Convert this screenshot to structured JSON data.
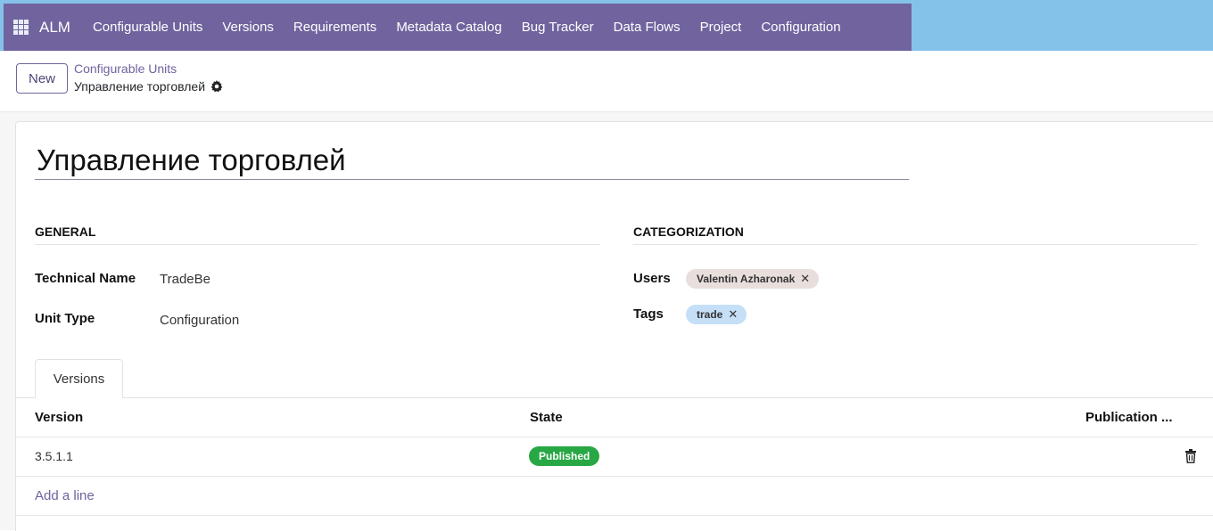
{
  "navbar": {
    "brand": "ALM",
    "items": [
      "Configurable Units",
      "Versions",
      "Requirements",
      "Metadata Catalog",
      "Bug Tracker",
      "Data Flows",
      "Project",
      "Configuration"
    ]
  },
  "control_panel": {
    "new_label": "New",
    "breadcrumb_parent": "Configurable Units",
    "breadcrumb_current": "Управление торговлей"
  },
  "record": {
    "title": "Управление торговлей",
    "general": {
      "heading": "GENERAL",
      "technical_name_label": "Technical Name",
      "technical_name_value": "TradeBe",
      "unit_type_label": "Unit Type",
      "unit_type_value": "Configuration"
    },
    "categorization": {
      "heading": "CATEGORIZATION",
      "users_label": "Users",
      "users": [
        "Valentin Azharonak"
      ],
      "tags_label": "Tags",
      "tags": [
        "trade"
      ]
    }
  },
  "tabs": [
    "Versions"
  ],
  "versions_table": {
    "columns": [
      "Version",
      "State",
      "Publication ..."
    ],
    "rows": [
      {
        "version": "3.5.1.1",
        "state": "Published"
      }
    ],
    "add_line": "Add a line"
  },
  "colors": {
    "navbar_bg": "#85c2e9",
    "menu_bg": "#71639e",
    "published_badge": "#28a745",
    "user_tag": "#e8dfdc",
    "tag_blue": "#c5dff7"
  },
  "icons": {
    "apps": "apps-grid-icon",
    "settings": "gear-icon",
    "remove_tag": "close-icon",
    "delete_row": "trash-icon"
  }
}
